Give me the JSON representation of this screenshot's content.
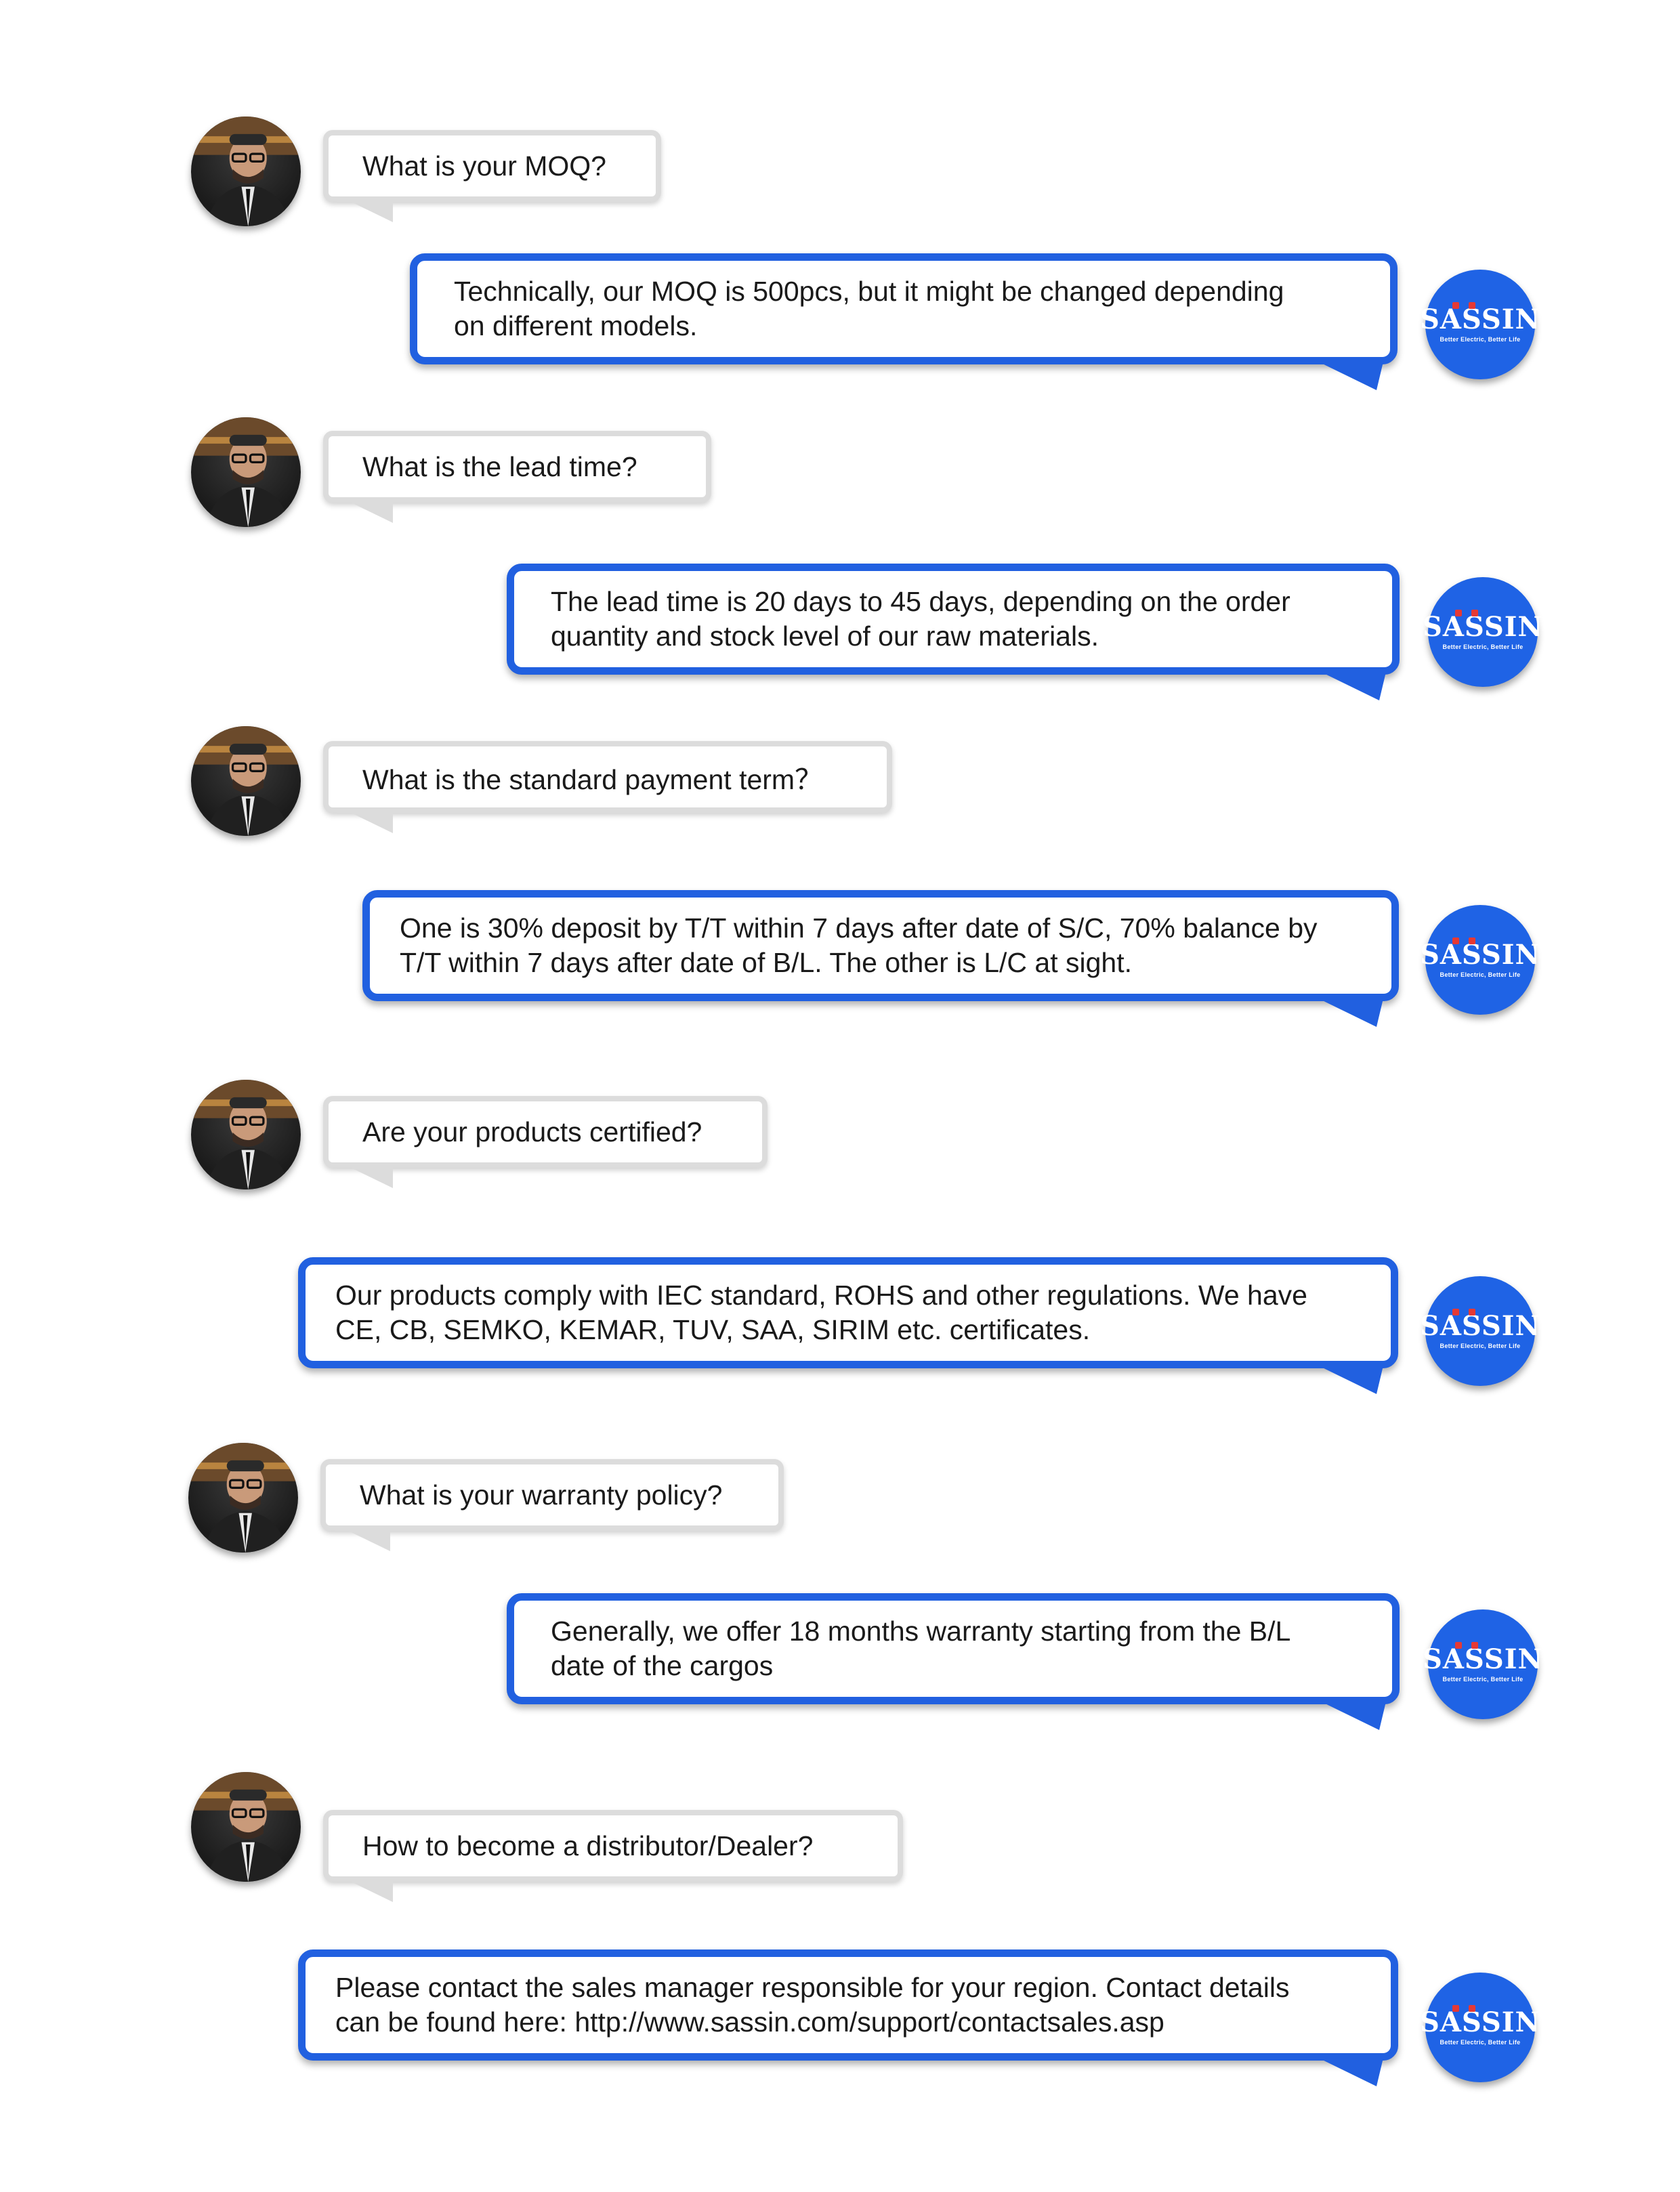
{
  "brand": {
    "name": "SASSIN",
    "tagline": "Better Electric, Better Life",
    "color": "#1f63e5",
    "accent": "#2160e0"
  },
  "conversation": [
    {
      "question": "What is your MOQ?",
      "answer": "Technically, our MOQ is 500pcs, but it might be changed depending\non different models."
    },
    {
      "question": "What is the lead time?",
      "answer": "The lead time is 20 days to 45 days, depending on the order\nquantity and stock level of our raw materials."
    },
    {
      "question": "What is the standard payment term？",
      "answer": "One is 30% deposit by T/T within 7 days after date of S/C, 70% balance by\nT/T within 7 days after date of B/L. The other is L/C at sight."
    },
    {
      "question": "Are your products certified?",
      "answer": "Our products comply with IEC standard, ROHS and other regulations. We have\nCE, CB, SEMKO, KEMAR, TUV, SAA, SIRIM etc. certificates."
    },
    {
      "question": "What is your warranty policy?",
      "answer": "Generally, we offer 18 months warranty starting from the B/L\ndate of the cargos"
    },
    {
      "question": "How to become a distributor/Dealer?",
      "answer": "Please contact the sales manager responsible for your region. Contact details\ncan be found here: http://www.sassin.com/support/contactsales.asp"
    }
  ]
}
